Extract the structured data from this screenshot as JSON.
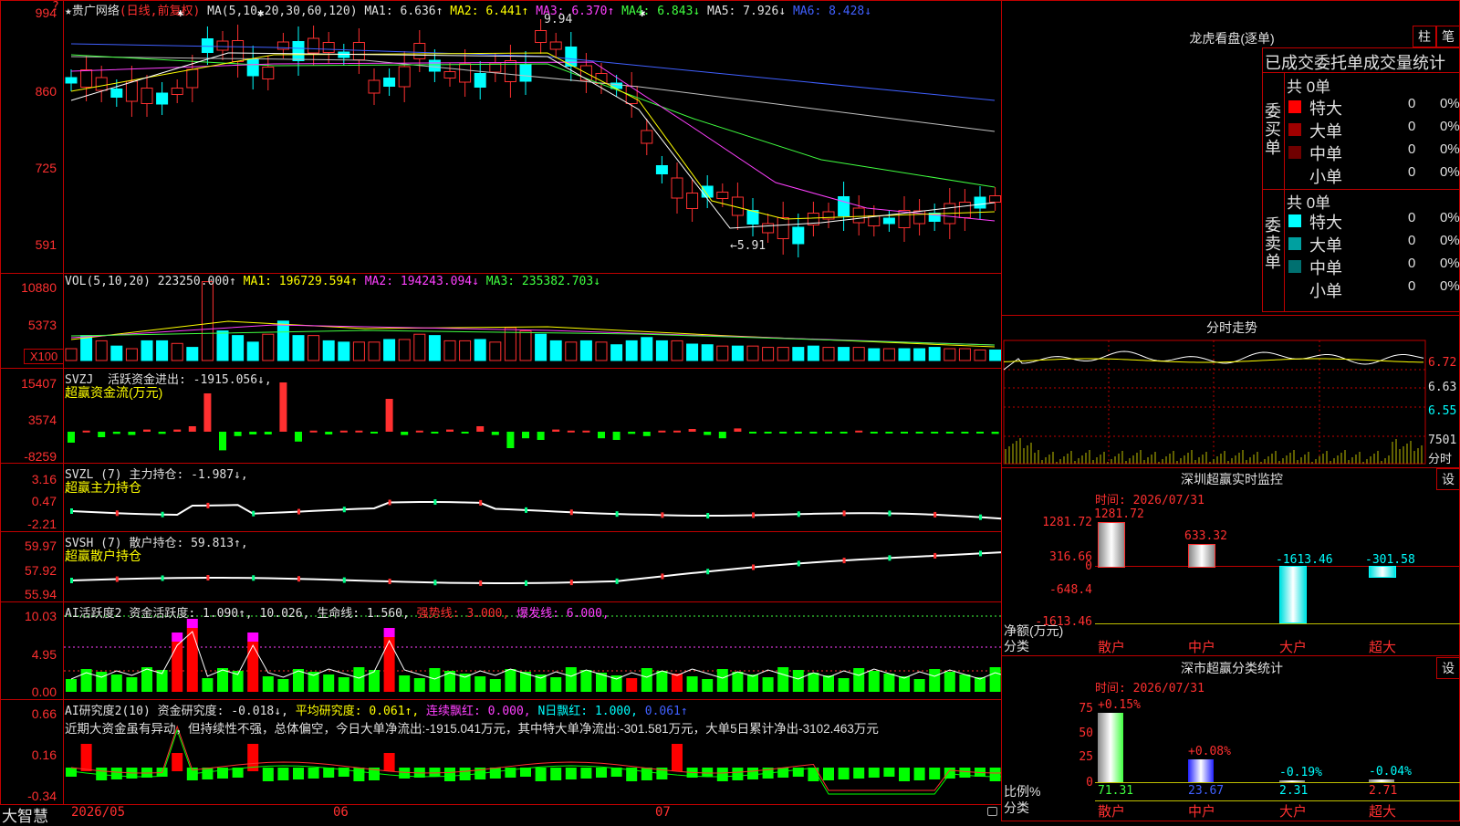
{
  "main": {
    "title_prefix": "★",
    "stock_name": "贵广网络",
    "period": "(日线,前复权)",
    "ma_label": "MA(5,10,20,30,60,120)",
    "ma1": "MA1: 6.636↑",
    "ma2": "MA2: 6.441↑",
    "ma3": "MA3: 6.370↑",
    "ma4": "MA4: 6.843↓",
    "ma5": "MA5: 7.926↓",
    "ma6": "MA6: 8.428↓",
    "y_ticks": [
      "994",
      "860",
      "725",
      "591"
    ],
    "high_mark": "9.94",
    "low_mark": "←5.91",
    "corner_mark": "?"
  },
  "vol": {
    "label": "VOL(5,10,20)",
    "value": "223250.000↑",
    "ma1": "MA1: 196729.594↑",
    "ma2": "MA2: 194243.094↓",
    "ma3": "MA3: 235382.703↓",
    "y_ticks": [
      "10880",
      "5373",
      "X100"
    ],
    "values": [
      18,
      38,
      30,
      22,
      18,
      30,
      30,
      26,
      20,
      120,
      45,
      38,
      28,
      40,
      60,
      38,
      38,
      30,
      28,
      28,
      28,
      32,
      32,
      40,
      38,
      30,
      30,
      32,
      28,
      50,
      45,
      40,
      30,
      28,
      30,
      28,
      24,
      30,
      35,
      30,
      30,
      25,
      24,
      22,
      22,
      22,
      20,
      20,
      20,
      22,
      20,
      20,
      20,
      18,
      18,
      18,
      18,
      20,
      18,
      18,
      16,
      16,
      16,
      14
    ],
    "colors": [
      "r",
      "c",
      "r",
      "c",
      "r",
      "c",
      "c",
      "r",
      "c",
      "r",
      "c",
      "c",
      "c",
      "r",
      "c",
      "c",
      "r",
      "c",
      "c",
      "r",
      "r",
      "c",
      "r",
      "r",
      "c",
      "r",
      "r",
      "c",
      "r",
      "r",
      "r",
      "c",
      "c",
      "r",
      "c",
      "r",
      "c",
      "c",
      "c",
      "c",
      "r",
      "c",
      "c",
      "r",
      "c",
      "r",
      "r",
      "r",
      "c",
      "c",
      "r",
      "c",
      "r",
      "c",
      "r",
      "c",
      "c",
      "c",
      "r",
      "r",
      "r",
      "c",
      "c",
      "r"
    ]
  },
  "svzj": {
    "name": "SVZJ",
    "label": "活跃资金进出: -1915.056↓,",
    "sub": "超赢资金流(万元)",
    "y_ticks": [
      "15407",
      "3574",
      "-8259"
    ],
    "values": [
      -20,
      2,
      -10,
      -4,
      -6,
      4,
      -4,
      4,
      10,
      70,
      -34,
      -8,
      -5,
      -5,
      90,
      -18,
      2,
      -5,
      2,
      2,
      -3,
      60,
      -6,
      2,
      -3,
      4,
      -2,
      10,
      -6,
      -30,
      -12,
      -15,
      4,
      2,
      2,
      -12,
      -15,
      -4,
      -8,
      2,
      2,
      5,
      -6,
      -12,
      6,
      -3,
      -2,
      -2,
      -3,
      -3,
      -2,
      -3,
      2,
      -3,
      -2,
      -2,
      -3,
      -2,
      -3,
      -2,
      -3,
      -4,
      -3,
      -4
    ],
    "colors": [
      "g",
      "r",
      "g",
      "g",
      "g",
      "r",
      "g",
      "r",
      "r",
      "r",
      "g",
      "g",
      "g",
      "g",
      "r",
      "g",
      "r",
      "g",
      "r",
      "r",
      "g",
      "r",
      "g",
      "r",
      "g",
      "r",
      "g",
      "r",
      "g",
      "g",
      "g",
      "g",
      "r",
      "r",
      "r",
      "g",
      "g",
      "g",
      "g",
      "r",
      "r",
      "r",
      "g",
      "g",
      "r",
      "g",
      "g",
      "g",
      "g",
      "g",
      "g",
      "g",
      "r",
      "g",
      "g",
      "g",
      "g",
      "g",
      "g",
      "g",
      "g",
      "g",
      "g",
      "g"
    ]
  },
  "svzl": {
    "name": "SVZL",
    "label": "(7) 主力持仓: -1.987↓,",
    "sub": "超赢主力持仓",
    "y_ticks": [
      "3.16",
      "0.47",
      "-2.21"
    ]
  },
  "svsh": {
    "name": "SVSH",
    "label": "(7) 散户持仓: 59.813↑,",
    "sub": "超赢散户持仓",
    "y_ticks": [
      "59.97",
      "57.92",
      "55.94"
    ]
  },
  "ai1": {
    "label1": "AI活跃度2",
    "label2": "资金活跃度: 1.090↑,",
    "label3": "10.026,",
    "label4": "生命线: 1.560,",
    "label5": "强势线: 3.000,",
    "label6": "爆发线: 6.000,",
    "y_ticks": [
      "10.03",
      "4.95",
      "0.00"
    ]
  },
  "ai2": {
    "label1": "AI研究度2(10)",
    "label2": "资金研究度: -0.018↓,",
    "label3": "平均研究度: 0.061↑,",
    "label4": "连续飘红: 0.000,",
    "label5": "N日飘红: 1.000,",
    "label6": "0.061↑",
    "desc": "近期大资金虽有异动，但持续性不强，总体偏空，今日大单净流出:-1915.041万元，其中特大单净流出:-301.581万元，大单5日累计净出-3102.463万元",
    "y_ticks": [
      "0.66",
      "0.16",
      "-0.34"
    ]
  },
  "footer": {
    "brand": "大智慧",
    "dates": [
      "2026/05",
      "06",
      "07"
    ]
  },
  "dragon": {
    "title": "龙虎看盘(逐单)",
    "btn1": "柱",
    "btn2": "笔",
    "header": "已成交委托单成交量统计",
    "buy_label": "委买单",
    "sell_label": "委卖单",
    "buy_total": "共 0单",
    "sell_total": "共 0单",
    "buy_rows": [
      {
        "name": "特大",
        "count": "0",
        "pct": "0%",
        "color": "#ff0000"
      },
      {
        "name": "大单",
        "count": "0",
        "pct": "0%",
        "color": "#a00000"
      },
      {
        "name": "中单",
        "count": "0",
        "pct": "0%",
        "color": "#700000"
      },
      {
        "name": "小单",
        "count": "0",
        "pct": "0%",
        "color": ""
      }
    ],
    "sell_rows": [
      {
        "name": "特大",
        "count": "0",
        "pct": "0%",
        "color": "#00ffff"
      },
      {
        "name": "大单",
        "count": "0",
        "pct": "0%",
        "color": "#00a0a0"
      },
      {
        "name": "中单",
        "count": "0",
        "pct": "0%",
        "color": "#007070"
      },
      {
        "name": "小单",
        "count": "0",
        "pct": "0%",
        "color": ""
      }
    ]
  },
  "intraday": {
    "title": "分时走势",
    "ticks": [
      "6.72",
      "6.63",
      "6.55"
    ],
    "vol_tick": "7501",
    "vol_label": "分时"
  },
  "sz_monitor": {
    "title": "深圳超赢实时监控",
    "btn": "设",
    "time": "时间: 2026/07/31",
    "y_ticks": [
      "1281.72",
      "316.66",
      "0",
      "-648.4",
      "-1613.46"
    ],
    "unit": "净额(万元)",
    "cat_label": "分类",
    "categories": [
      "散户",
      "中户",
      "大户",
      "超大"
    ],
    "values": [
      1281.72,
      633.32,
      -1613.46,
      -301.58
    ],
    "value_labels": [
      "1281.72",
      "633.32",
      "-1613.46",
      "-301.58"
    ]
  },
  "sz_class": {
    "title": "深市超赢分类统计",
    "btn": "设",
    "time": "时间: 2026/07/31",
    "y_ticks": [
      "75",
      "50",
      "25",
      "0"
    ],
    "unit": "比例%",
    "cat_label": "分类",
    "categories": [
      "散户",
      "中户",
      "大户",
      "超大"
    ],
    "values": [
      71.31,
      23.67,
      2.31,
      2.71
    ],
    "value_labels": [
      "71.31",
      "23.67",
      "2.31",
      "2.71"
    ],
    "change_labels": [
      "+0.15%",
      "+0.08%",
      "-0.19%",
      "-0.04%"
    ]
  }
}
